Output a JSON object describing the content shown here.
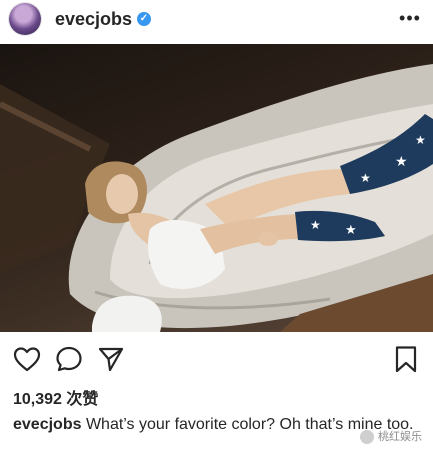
{
  "header": {
    "username": "evecjobs",
    "verified_symbol": "✓",
    "more_label": "•••"
  },
  "actions": {
    "icons": [
      "heart-icon",
      "comment-icon",
      "share-icon",
      "bookmark-icon"
    ]
  },
  "likes": {
    "count_label": "10,392 次赞"
  },
  "caption": {
    "username": "evecjobs",
    "text": "What’s your favorite color? Oh that’s mine too."
  },
  "watermark": {
    "text": "桃红娱乐"
  },
  "colors": {
    "verified_blue": "#3897f0",
    "text_dark": "#262626"
  }
}
